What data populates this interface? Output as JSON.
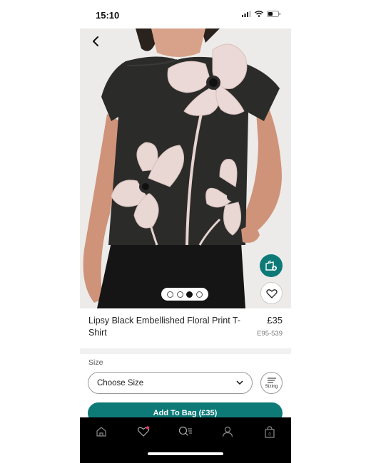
{
  "status_bar": {
    "time": "15:10"
  },
  "gallery": {
    "image_count": 4,
    "active_index": 2
  },
  "product": {
    "name": "Lipsy Black Embellished Floral Print T-Shirt",
    "price": "£35",
    "code": "E95-539"
  },
  "size": {
    "label": "Size",
    "select_placeholder": "Choose Size",
    "sizing_label": "Sizing"
  },
  "add_to_bag": {
    "label": "Add To Bag (£35)"
  },
  "nav": {
    "items": [
      "home-icon",
      "heart-icon",
      "search-icon",
      "account-icon",
      "bag-icon"
    ],
    "bag_count": "0"
  },
  "colors": {
    "accent": "#0d7a78",
    "nav_bg": "#000000",
    "fav_dot": "#e0336f"
  }
}
